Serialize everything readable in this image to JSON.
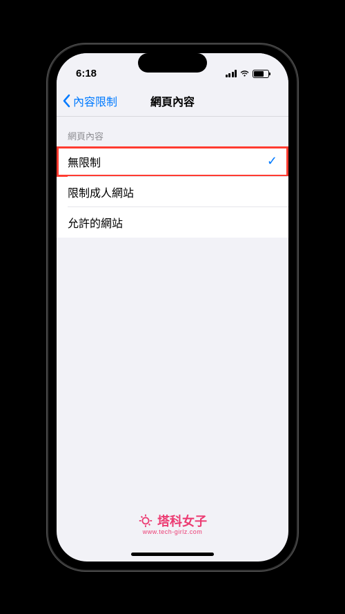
{
  "status": {
    "time": "6:18"
  },
  "nav": {
    "back_label": "內容限制",
    "title": "網頁內容"
  },
  "section": {
    "header": "網頁內容",
    "options": [
      {
        "label": "無限制",
        "selected": true,
        "highlighted": true
      },
      {
        "label": "限制成人網站",
        "selected": false,
        "highlighted": false
      },
      {
        "label": "允許的網站",
        "selected": false,
        "highlighted": false
      }
    ]
  },
  "watermark": {
    "brand": "塔科女子",
    "url": "www.tech-girlz.com"
  }
}
